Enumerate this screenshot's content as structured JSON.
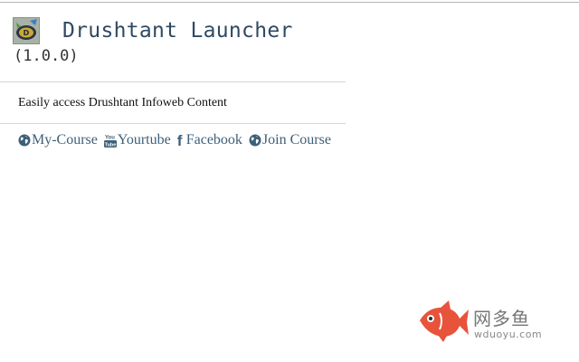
{
  "app": {
    "title": "Drushtant Launcher",
    "version": "(1.0.0)",
    "logo_icon": "drushtant-logo-icon"
  },
  "description": "Easily access Drushtant Infoweb Content",
  "links": [
    {
      "label": "My-Course",
      "icon": "globe-icon"
    },
    {
      "label": "Yourtube",
      "icon": "youtube-icon"
    },
    {
      "label": "Facebook",
      "icon": "facebook-icon"
    },
    {
      "label": "Join Course",
      "icon": "globe-icon"
    }
  ],
  "watermark": {
    "cn": "网多鱼",
    "en": "wduoyu.com"
  },
  "colors": {
    "title": "#2f4a63",
    "link": "#3d6079",
    "divider": "#d6d6d6",
    "watermark_fish": "#e8533c"
  }
}
